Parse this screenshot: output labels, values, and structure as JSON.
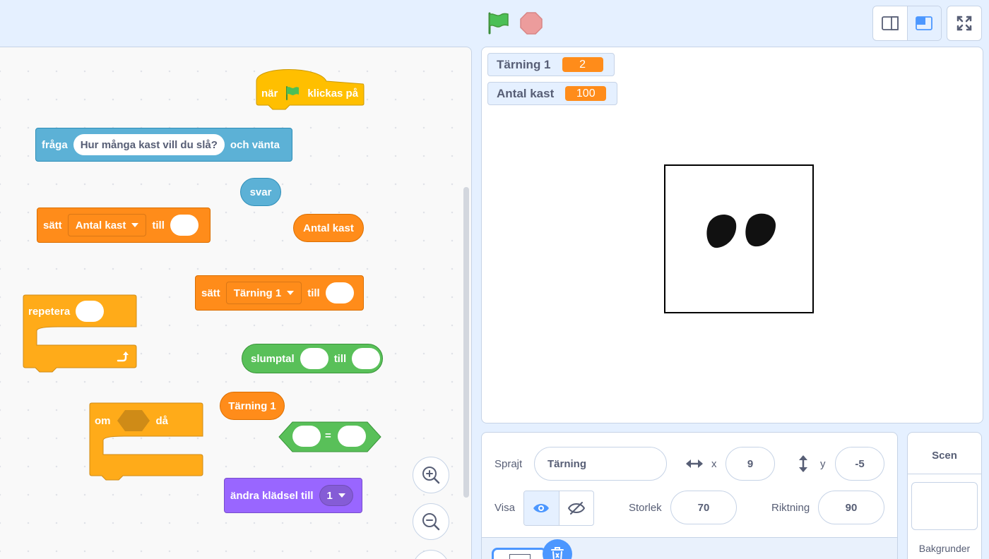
{
  "topbar": {
    "green_flag_icon": "green-flag-icon",
    "stop_icon": "stop-icon"
  },
  "blocks": {
    "when_flag": {
      "prefix": "när",
      "suffix": "klickas på"
    },
    "ask": {
      "prefix": "fråga",
      "question": "Hur många kast vill du slå?",
      "suffix": "och vänta"
    },
    "answer": {
      "label": "svar"
    },
    "set_var1": {
      "prefix": "sätt",
      "variable": "Antal kast",
      "suffix": "till"
    },
    "var_reporter1": {
      "label": "Antal kast"
    },
    "set_var2": {
      "prefix": "sätt",
      "variable": "Tärning 1",
      "suffix": "till"
    },
    "repeat": {
      "label": "repetera"
    },
    "random": {
      "prefix": "slumptal",
      "middle": "till"
    },
    "var_reporter2": {
      "label": "Tärning 1"
    },
    "equals": {
      "operator": "="
    },
    "if": {
      "prefix": "om",
      "suffix": "då"
    },
    "costume": {
      "prefix": "ändra klädsel till",
      "value": "1"
    }
  },
  "stage": {
    "monitors": [
      {
        "name": "Tärning 1",
        "value": "2"
      },
      {
        "name": "Antal kast",
        "value": "100"
      }
    ],
    "dice_value": 2
  },
  "sprite_info": {
    "sprite_label": "Sprajt",
    "sprite_name": "Tärning",
    "x_label": "x",
    "x_value": "9",
    "y_label": "y",
    "y_value": "-5",
    "show_label": "Visa",
    "size_label": "Storlek",
    "size_value": "70",
    "direction_label": "Riktning",
    "direction_value": "90"
  },
  "scene_pane": {
    "title": "Scen",
    "backdrops_label": "Bakgrunder"
  },
  "colors": {
    "events": "#ffbf00",
    "sensing": "#5cb1d6",
    "variables": "#ff8c1a",
    "control": "#ffab19",
    "operators": "#59c059",
    "looks": "#9966ff",
    "accent": "#4c97ff"
  }
}
